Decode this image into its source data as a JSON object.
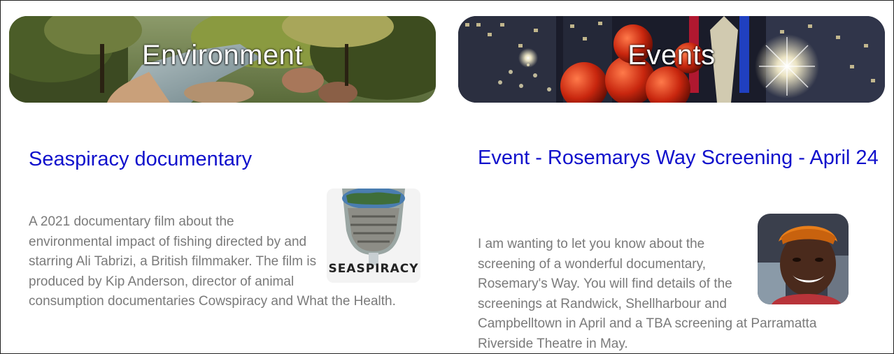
{
  "columns": [
    {
      "banner_title": "Environment",
      "post_title": "Seaspiracy documentary",
      "post_body": "A 2021 documentary film about the environmental impact of fishing directed by and starring Ali Tabrizi, a British filmmaker. The film is produced by Kip Anderson, director of animal consumption documentaries Cowspiracy and What the Health.",
      "thumbnail_word": "SEASPIRACY"
    },
    {
      "banner_title": "Events",
      "post_title": "Event - Rosemarys Way Screening - April 24",
      "post_body": "I am wanting to let you know about the screening of a wonderful documentary, Rosemary's Way. You will find details of the screenings at Randwick, Shellharbour and Campbelltown in April and a TBA screening at Parramatta Riverside Theatre in May."
    }
  ],
  "colors": {
    "title_link": "#1111cc",
    "body_text": "#7a7a7a",
    "banner_text": "#ffffff"
  }
}
